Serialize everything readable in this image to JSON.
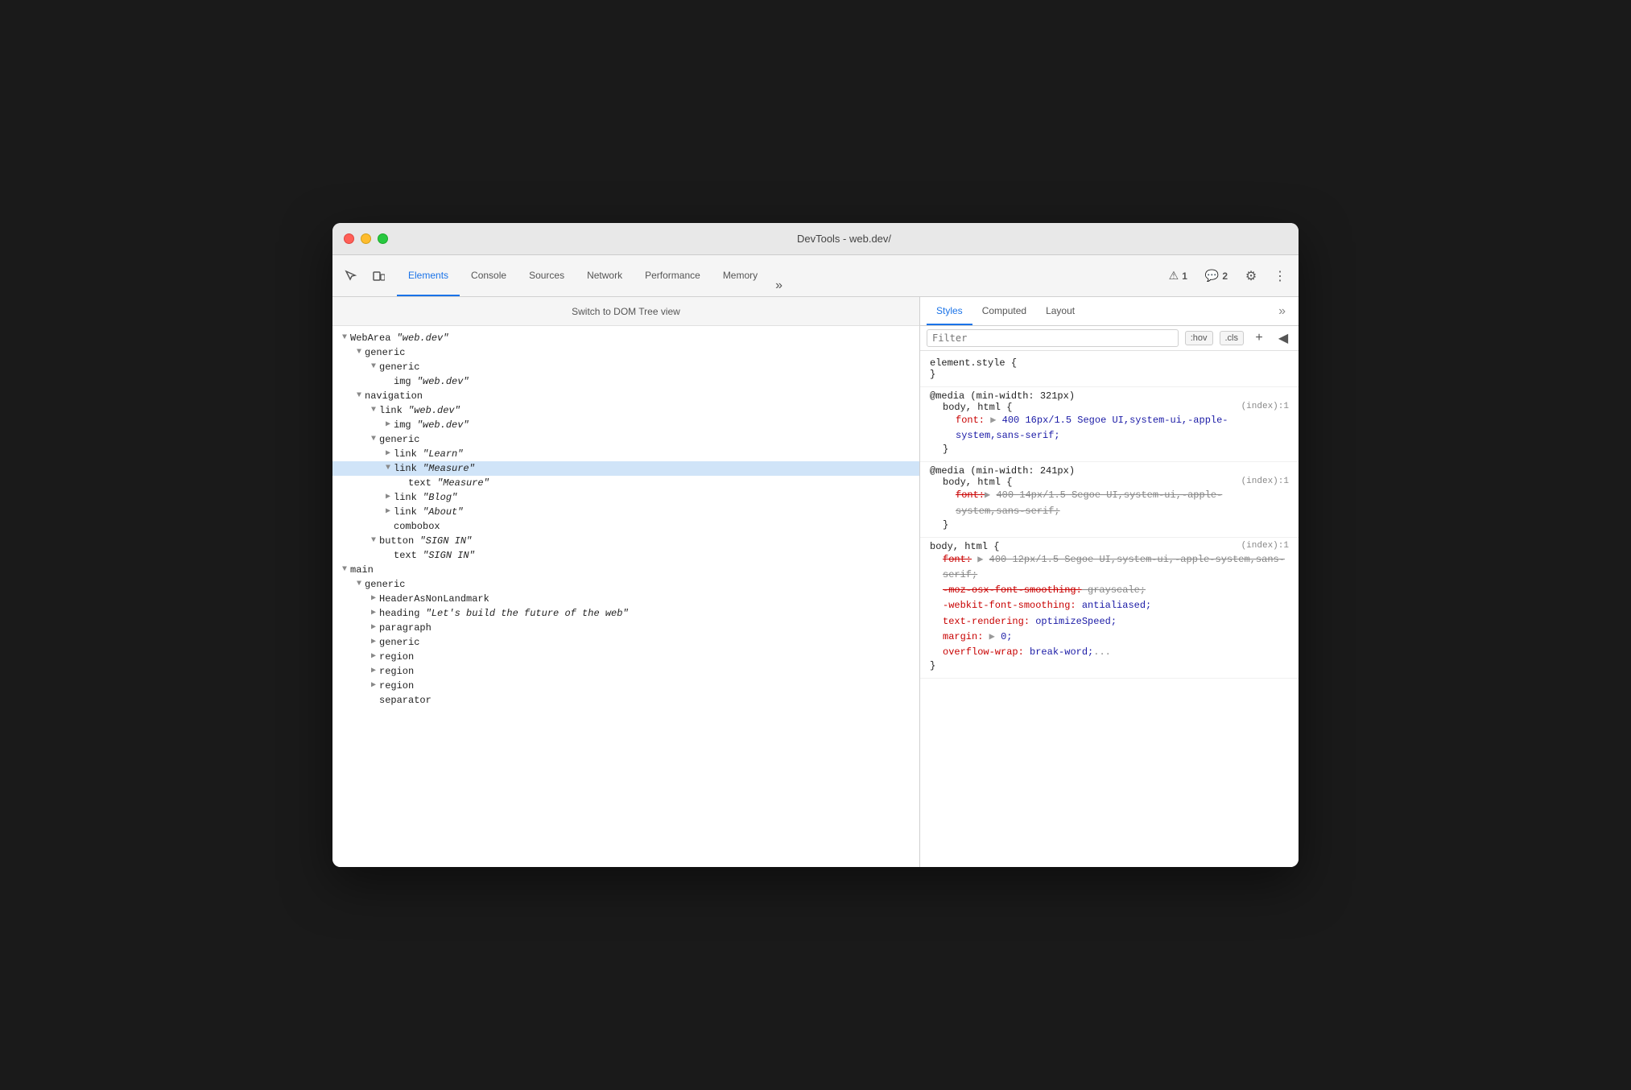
{
  "window": {
    "title": "DevTools - web.dev/"
  },
  "titlebar": {
    "traffic_lights": [
      "red",
      "yellow",
      "green"
    ]
  },
  "toolbar": {
    "icons": [
      {
        "name": "cursor-icon",
        "symbol": "↖"
      },
      {
        "name": "device-icon",
        "symbol": "📱"
      }
    ],
    "tabs": [
      {
        "label": "Elements",
        "active": true
      },
      {
        "label": "Console",
        "active": false
      },
      {
        "label": "Sources",
        "active": false
      },
      {
        "label": "Network",
        "active": false
      },
      {
        "label": "Performance",
        "active": false
      },
      {
        "label": "Memory",
        "active": false
      }
    ],
    "more_tabs_label": "»",
    "warning_count": "1",
    "message_count": "2",
    "settings_icon": "⚙",
    "more_options_icon": "⋮"
  },
  "dom_panel": {
    "toolbar_btn": "Switch to DOM Tree view",
    "tree": [
      {
        "id": 1,
        "depth": 0,
        "toggle": "▼",
        "text": "WebArea ",
        "italic": "\"web.dev\"",
        "selected": false
      },
      {
        "id": 2,
        "depth": 1,
        "toggle": "▼",
        "text": "generic",
        "italic": "",
        "selected": false
      },
      {
        "id": 3,
        "depth": 2,
        "toggle": "▼",
        "text": "generic",
        "italic": "",
        "selected": false
      },
      {
        "id": 4,
        "depth": 3,
        "toggle": "",
        "text": "img ",
        "italic": "\"web.dev\"",
        "selected": false
      },
      {
        "id": 5,
        "depth": 1,
        "toggle": "▼",
        "text": "navigation",
        "italic": "",
        "selected": false
      },
      {
        "id": 6,
        "depth": 2,
        "toggle": "▼",
        "text": "link ",
        "italic": "\"web.dev\"",
        "selected": false
      },
      {
        "id": 7,
        "depth": 3,
        "toggle": "▶",
        "text": "img ",
        "italic": "\"web.dev\"",
        "selected": false
      },
      {
        "id": 8,
        "depth": 2,
        "toggle": "▼",
        "text": "generic",
        "italic": "",
        "selected": false
      },
      {
        "id": 9,
        "depth": 3,
        "toggle": "▶",
        "text": "link ",
        "italic": "\"Learn\"",
        "selected": false
      },
      {
        "id": 10,
        "depth": 3,
        "toggle": "▼",
        "text": "link ",
        "italic": "\"Measure\"",
        "selected": true
      },
      {
        "id": 11,
        "depth": 4,
        "toggle": "",
        "text": "text ",
        "italic": "\"Measure\"",
        "selected": false
      },
      {
        "id": 12,
        "depth": 3,
        "toggle": "▶",
        "text": "link ",
        "italic": "\"Blog\"",
        "selected": false
      },
      {
        "id": 13,
        "depth": 3,
        "toggle": "▶",
        "text": "link ",
        "italic": "\"About\"",
        "selected": false
      },
      {
        "id": 14,
        "depth": 3,
        "toggle": "",
        "text": "combobox",
        "italic": "",
        "selected": false
      },
      {
        "id": 15,
        "depth": 2,
        "toggle": "▼",
        "text": "button ",
        "italic": "\"SIGN IN\"",
        "selected": false
      },
      {
        "id": 16,
        "depth": 3,
        "toggle": "",
        "text": "text ",
        "italic": "\"SIGN IN\"",
        "selected": false
      },
      {
        "id": 17,
        "depth": 0,
        "toggle": "▼",
        "text": "main",
        "italic": "",
        "selected": false
      },
      {
        "id": 18,
        "depth": 1,
        "toggle": "▼",
        "text": "generic",
        "italic": "",
        "selected": false
      },
      {
        "id": 19,
        "depth": 2,
        "toggle": "▶",
        "text": "HeaderAsNonLandmark",
        "italic": "",
        "selected": false
      },
      {
        "id": 20,
        "depth": 2,
        "toggle": "▶",
        "text": "heading ",
        "italic": "\"Let's build the future of the web\"",
        "selected": false
      },
      {
        "id": 21,
        "depth": 2,
        "toggle": "▶",
        "text": "paragraph",
        "italic": "",
        "selected": false
      },
      {
        "id": 22,
        "depth": 2,
        "toggle": "▶",
        "text": "generic",
        "italic": "",
        "selected": false
      },
      {
        "id": 23,
        "depth": 2,
        "toggle": "▶",
        "text": "region",
        "italic": "",
        "selected": false
      },
      {
        "id": 24,
        "depth": 2,
        "toggle": "▶",
        "text": "region",
        "italic": "",
        "selected": false
      },
      {
        "id": 25,
        "depth": 2,
        "toggle": "▶",
        "text": "region",
        "italic": "",
        "selected": false
      },
      {
        "id": 26,
        "depth": 2,
        "toggle": "",
        "text": "separator",
        "italic": "",
        "selected": false
      }
    ]
  },
  "styles_panel": {
    "tabs": [
      {
        "label": "Styles",
        "active": true
      },
      {
        "label": "Computed",
        "active": false
      },
      {
        "label": "Layout",
        "active": false
      }
    ],
    "more_tabs": "»",
    "filter_placeholder": "Filter",
    "hov_btn": ":hov",
    "cls_btn": ".cls",
    "add_btn": "+",
    "toggle_btn": "◀",
    "rules": [
      {
        "id": "r1",
        "selector": "element.style {",
        "close": "}",
        "source": "",
        "properties": []
      },
      {
        "id": "r2",
        "at_rule": "@media (min-width: 321px)",
        "selector": "body, html {",
        "close": "}",
        "source": "(index):1",
        "properties": [
          {
            "prop": "font:",
            "triangle": "▶",
            "value": "400 16px/1.5 Segoe UI,system-ui,-apple-system,sans-serif;",
            "strikethrough": false
          }
        ]
      },
      {
        "id": "r3",
        "at_rule": "@media (min-width: 241px)",
        "selector": "body, html {",
        "close": "}",
        "source": "(index):1",
        "properties": [
          {
            "prop": "font:",
            "triangle": "▶",
            "value": "400 14px/1.5 Segoe UI,system-ui,-apple-system,sans-serif;",
            "strikethrough": true
          }
        ]
      },
      {
        "id": "r4",
        "selector": "body, html {",
        "close": "}",
        "source": "(index):1",
        "properties": [
          {
            "prop": "font:",
            "triangle": "▶",
            "value": "400 12px/1.5 Segoe UI,system-ui,-apple-system,sans-serif;",
            "strikethrough": true
          },
          {
            "prop": "-moz-osx-font-smoothing:",
            "value": "grayscale;",
            "strikethrough": true
          },
          {
            "prop": "-webkit-font-smoothing:",
            "value": "antialiased;",
            "strikethrough": false,
            "prop_color": "red"
          },
          {
            "prop": "text-rendering:",
            "value": "optimizeSpeed;",
            "strikethrough": false,
            "prop_color": "red"
          },
          {
            "prop": "margin:",
            "triangle": "▶",
            "value": "0;",
            "strikethrough": false,
            "prop_color": "red"
          },
          {
            "prop": "overflow-wrap:",
            "value": "break-word;",
            "strikethrough": false,
            "partial": true,
            "prop_color": "red"
          }
        ]
      }
    ]
  }
}
